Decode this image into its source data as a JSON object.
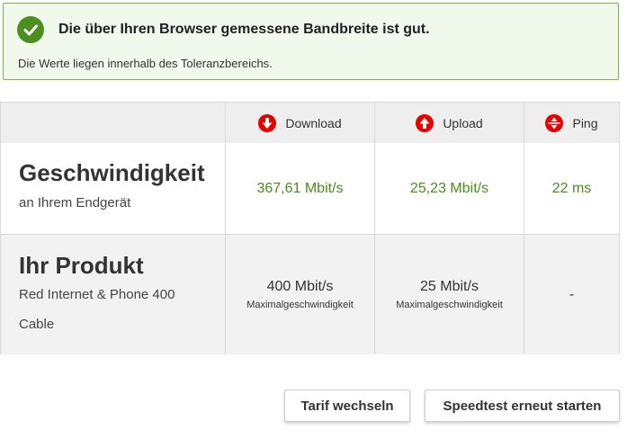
{
  "alert": {
    "title": "Die über Ihren Browser gemessene Bandbreite ist gut.",
    "subtitle": "Die Werte liegen innerhalb des Toleranzbereichs.",
    "icon": "check-circle-icon",
    "color": "#4d8f1f"
  },
  "table": {
    "headers": {
      "download": "Download",
      "upload": "Upload",
      "ping": "Ping"
    },
    "speed_row": {
      "title": "Geschwindigkeit",
      "subtitle": "an Ihrem Endgerät",
      "download": "367,61 Mbit/s",
      "upload": "25,23 Mbit/s",
      "ping": "22 ms"
    },
    "product_row": {
      "title": "Ihr Produkt",
      "subtitle": "Red Internet & Phone 400",
      "subtitle2": "Cable",
      "download": "400 Mbit/s",
      "download_note": "Maximalgeschwindigkeit",
      "upload": "25 Mbit/s",
      "upload_note": "Maximalgeschwindigkeit",
      "ping": "-"
    }
  },
  "buttons": {
    "change_tariff": "Tarif wechseln",
    "restart_test": "Speedtest erneut starten"
  },
  "colors": {
    "accent_red": "#e60000",
    "value_green": "#4a8c1c"
  }
}
